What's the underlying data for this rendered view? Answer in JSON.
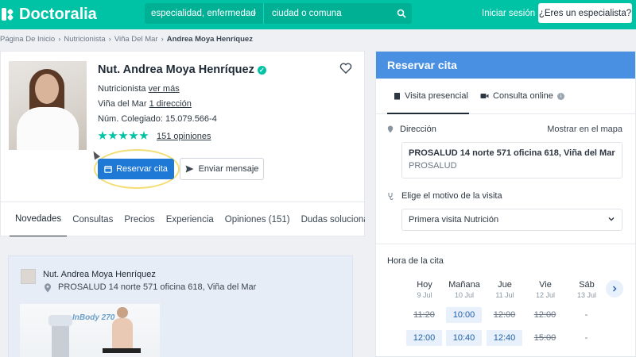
{
  "header": {
    "brand": "Doctoralia",
    "search_specialty": "especialidad, enfermedad",
    "search_city": "ciudad o comuna",
    "login": "Iniciar sesión",
    "specialist_cta": "¿Eres un especialista?"
  },
  "breadcrumb": {
    "items": [
      "Página De Inicio",
      "Nutricionista",
      "Viña Del Mar"
    ],
    "current": "Andrea Moya Henríquez"
  },
  "profile": {
    "name": "Nut. Andrea Moya Henríquez",
    "specialty": "Nutricionista",
    "specialty_link": "ver más",
    "city": "Viña del Mar",
    "address_link": "1 dirección",
    "college": "Núm. Colegiado: 15.079.566-4",
    "rating_stars": 5,
    "opinions": "151 opiniones",
    "reserve_button": "Reservar cita",
    "message_button": "Enviar mensaje"
  },
  "tabs": [
    "Novedades",
    "Consultas",
    "Precios",
    "Experiencia",
    "Opiniones (151)",
    "Dudas solucionadas"
  ],
  "address_card": {
    "name": "Nut. Andrea Moya Henríquez",
    "address": "PROSALUD 14 norte 571 oficina 618, Viña del Mar",
    "image_label": "InBody 270"
  },
  "booking": {
    "title": "Reservar cita",
    "tab_presencial": "Visita presencial",
    "tab_online": "Consulta online",
    "direccion_label": "Dirección",
    "map_link": "Mostrar en el mapa",
    "address_line1": "PROSALUD 14 norte 571 oficina 618, Viña del Mar",
    "address_line2": "PROSALUD",
    "motivo_label": "Elige el motivo de la visita",
    "motivo_value": "Primera visita Nutrición",
    "hora_label": "Hora de la cita",
    "days": [
      {
        "name": "Hoy",
        "date": "9 Jul"
      },
      {
        "name": "Mañana",
        "date": "10 Jul"
      },
      {
        "name": "Jue",
        "date": "11 Jul"
      },
      {
        "name": "Vie",
        "date": "12 Jul"
      },
      {
        "name": "Sáb",
        "date": "13 Jul"
      }
    ],
    "slots_row1": [
      "11:20",
      "10:00",
      "12:00",
      "12:00",
      "-"
    ],
    "slots_row2": [
      "12:00",
      "10:40",
      "12:40",
      "15:00",
      "-"
    ]
  },
  "colors": {
    "brand": "#00c3a5",
    "primary_blue": "#1e78d6",
    "panel_header": "#4a90e2"
  }
}
